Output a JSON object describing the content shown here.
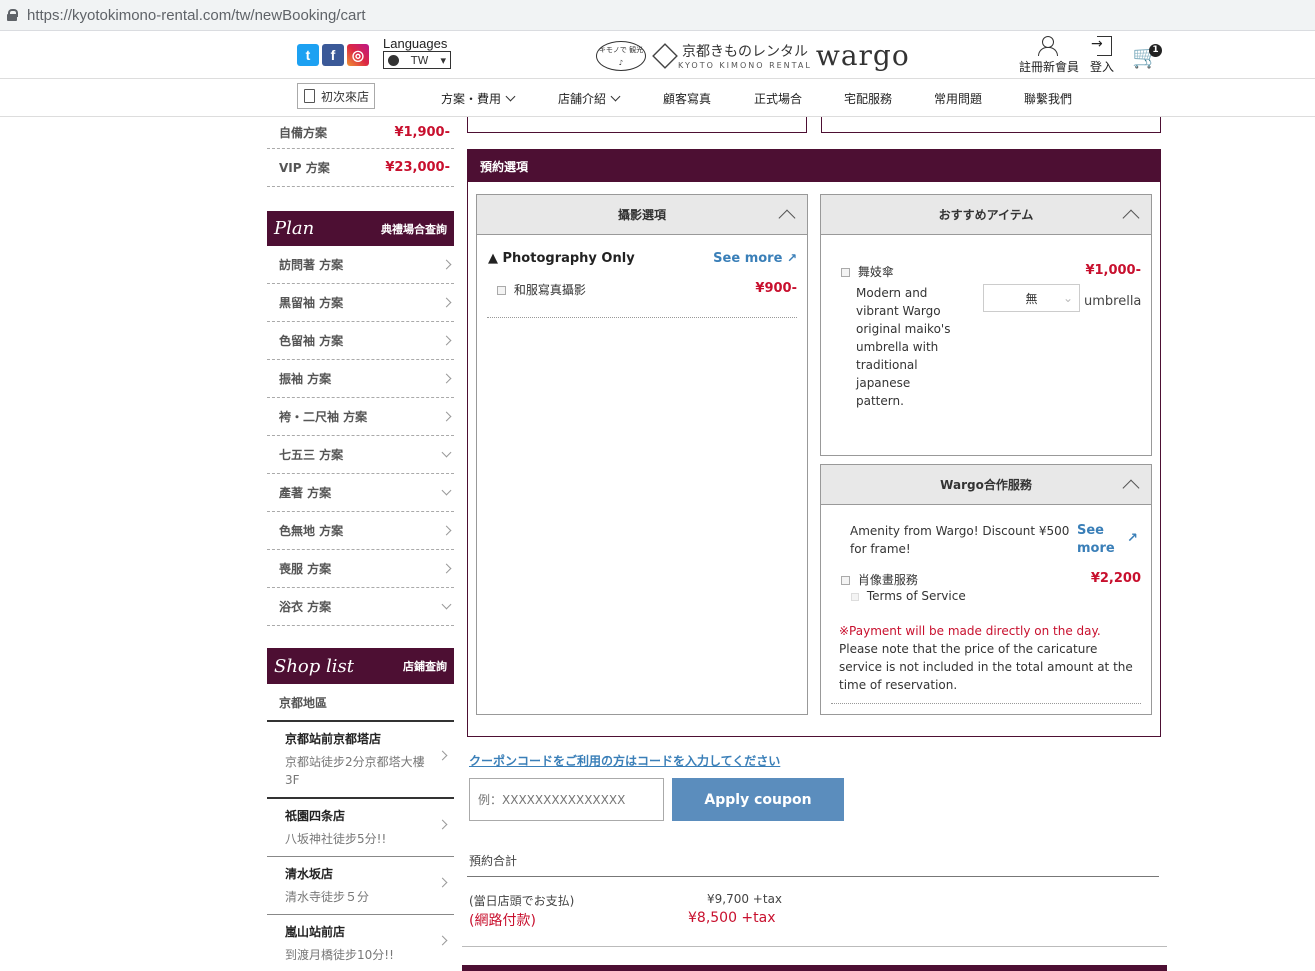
{
  "browser": {
    "url": "https://kyotokimono-rental.com/tw/newBooking/cart"
  },
  "header": {
    "languages_label": "Languages",
    "language_value": "TW",
    "logo_bubble": "キモノで 観光♪",
    "logo_jp": "京都きものレンタル",
    "logo_sub": "KYOTO KIMONO RENTAL",
    "logo_brand": "wargo",
    "register_label": "註冊新會員",
    "login_label": "登入",
    "cart_count": "1"
  },
  "nav": {
    "first_visit": "初次來店",
    "items": [
      "方案・費用",
      "店舗介紹",
      "顧客寫真",
      "正式場合",
      "宅配服務",
      "常用問題",
      "聯繫我們"
    ]
  },
  "sidebar": {
    "top_rows": [
      {
        "label": "自備方案",
        "price": "¥1,900-"
      },
      {
        "label": "VIP 方案",
        "price": "¥23,000-"
      }
    ],
    "plan_title": "Plan",
    "plan_sub": "典禮場合查詢",
    "plans": [
      "訪問著 方案",
      "黒留袖 方案",
      "色留袖 方案",
      "振袖 方案",
      "袴・二尺袖 方案",
      "七五三 方案",
      "產著 方案",
      "色無地 方案",
      "喪服 方案",
      "浴衣 方案"
    ],
    "shop_title": "Shop list",
    "shop_sub": "店鋪查詢",
    "region": "京都地區",
    "shops": [
      {
        "name": "京都站前京都塔店",
        "addr": "京都站徒步2分京都塔大樓3F"
      },
      {
        "name": "祇園四条店",
        "addr": "八坂神社徒步5分!!"
      },
      {
        "name": "清水坂店",
        "addr": "清水寺徒步５分"
      },
      {
        "name": "嵐山站前店",
        "addr": "到渡月橋徒步10分!!"
      }
    ]
  },
  "booking": {
    "title": "預約選項",
    "photo": {
      "title": "攝影選項",
      "section": "▲ Photography Only",
      "see_more": "See more",
      "item_label": "和服寫真攝影",
      "item_price": "¥900-"
    },
    "recommend": {
      "title": "おすすめアイテム",
      "item_label": "舞妓傘",
      "item_price": "¥1,000-",
      "item_desc": "Modern and vibrant Wargo original maiko's umbrella with traditional japanese pattern.",
      "select_value": "無",
      "unit": "umbrella"
    },
    "partner": {
      "title": "Wargo合作服務",
      "amenity": "Amenity from Wargo! Discount ¥500 for frame!",
      "see_more": "See more",
      "item_label": "肖像畫服務",
      "item_price": "¥2,200",
      "terms": "Terms of Service",
      "note_red": "※Payment will be made directly on the day.",
      "note": "Please note that the price of the caricature service is not included in the total amount at the time of reservation."
    }
  },
  "coupon": {
    "link": "クーポンコードをご利用の方はコードを入力してください",
    "placeholder": "例：XXXXXXXXXXXXXXX",
    "button": "Apply coupon"
  },
  "total": {
    "title": "預約合計",
    "store_label": "(當日店頭でお支払)",
    "store_value": "¥9,700 +tax",
    "online_label": "(網路付款)",
    "online_value": "¥8,500 +tax"
  },
  "colors": {
    "brand": "#4d0f33",
    "price_red": "#c8102e",
    "link_blue": "#3a7fb8",
    "button_blue": "#5b8dbd"
  }
}
